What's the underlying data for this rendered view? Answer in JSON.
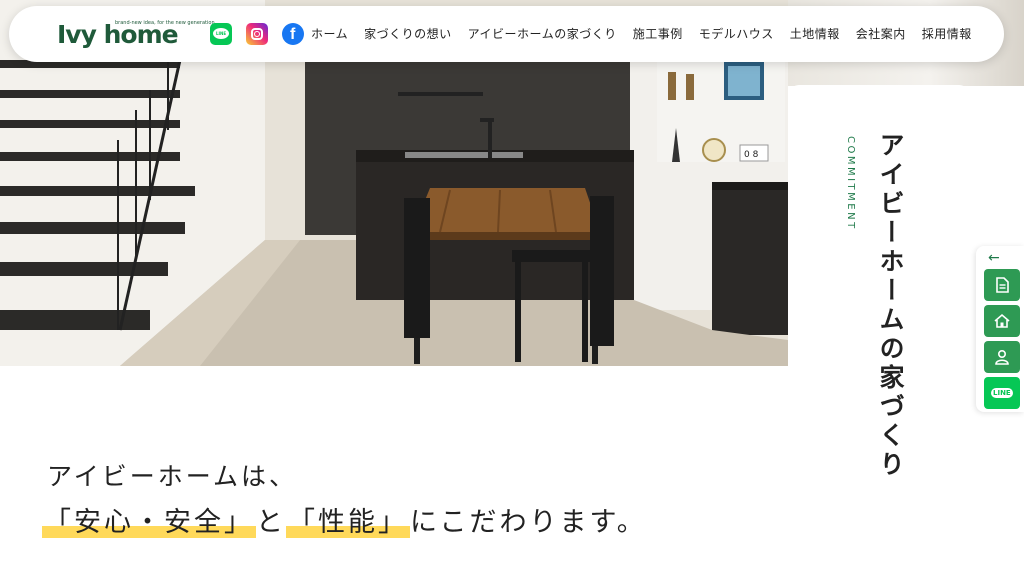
{
  "header": {
    "logo_text": "Ivy home",
    "logo_tagline": "brand-new idea, for the new generation",
    "social": [
      {
        "name": "line-icon",
        "label": "LINE"
      },
      {
        "name": "instagram-icon"
      },
      {
        "name": "facebook-icon",
        "label": "f"
      }
    ],
    "nav": [
      "ホーム",
      "家づくりの想い",
      "アイビーホームの家づくり",
      "施工事例",
      "モデルハウス",
      "土地情報",
      "会社案内",
      "採用情報"
    ]
  },
  "hero": {
    "section_label": "COMMITMENT",
    "title": "アイビーホームの家づくり",
    "calendar": "0 8"
  },
  "sidebar": {
    "toggle": "←",
    "buttons": [
      {
        "name": "document-icon"
      },
      {
        "name": "home-icon"
      },
      {
        "name": "user-icon"
      },
      {
        "name": "line-icon",
        "label": "LINE"
      }
    ]
  },
  "copy": {
    "line1": "アイビーホームは、",
    "hl1": "「安心・安全」",
    "mid": "と",
    "hl2": "「性能」",
    "end": "にこだわります。"
  },
  "colors": {
    "brand_green": "#1f5a3a",
    "accent_green": "#2e9a54",
    "line_green": "#06c755",
    "highlight_yellow": "#ffd95a"
  }
}
